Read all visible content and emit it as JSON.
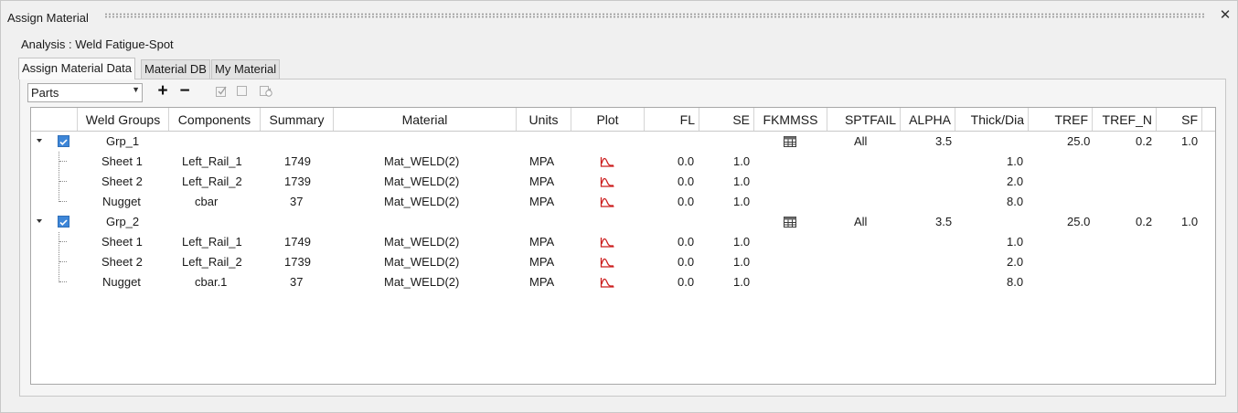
{
  "window": {
    "title": "Assign Material"
  },
  "analysis_label": "Analysis : Weld Fatigue-Spot",
  "tabs": [
    {
      "label": "Assign Material Data",
      "active": true
    },
    {
      "label": "Material DB",
      "active": false
    },
    {
      "label": "My Material",
      "active": false
    }
  ],
  "toolbar": {
    "selection_type": "Parts",
    "add": "+",
    "remove": "−"
  },
  "columns": [
    "Weld Groups",
    "Components",
    "Summary",
    "Material",
    "Units",
    "Plot",
    "FL",
    "SE",
    "FKMMSS",
    "SPTFAIL",
    "ALPHA",
    "Thick/Dia",
    "TREF",
    "TREF_N",
    "SF"
  ],
  "groups": [
    {
      "name": "Grp_1",
      "checked": true,
      "sptfail": "All",
      "alpha": "3.5",
      "tref": "25.0",
      "tref_n": "0.2",
      "sf": "1.0",
      "rows": [
        {
          "group": "Sheet 1",
          "component": "Left_Rail_1",
          "summary": "1749",
          "material": "Mat_WELD(2)",
          "units": "MPA",
          "fl": "0.0",
          "se": "1.0",
          "thick": "1.0"
        },
        {
          "group": "Sheet 2",
          "component": "Left_Rail_2",
          "summary": "1739",
          "material": "Mat_WELD(2)",
          "units": "MPA",
          "fl": "0.0",
          "se": "1.0",
          "thick": "2.0"
        },
        {
          "group": "Nugget",
          "component": "cbar",
          "summary": "37",
          "material": "Mat_WELD(2)",
          "units": "MPA",
          "fl": "0.0",
          "se": "1.0",
          "thick": "8.0"
        }
      ]
    },
    {
      "name": "Grp_2",
      "checked": true,
      "sptfail": "All",
      "alpha": "3.5",
      "tref": "25.0",
      "tref_n": "0.2",
      "sf": "1.0",
      "rows": [
        {
          "group": "Sheet 1",
          "component": "Left_Rail_1",
          "summary": "1749",
          "material": "Mat_WELD(2)",
          "units": "MPA",
          "fl": "0.0",
          "se": "1.0",
          "thick": "1.0"
        },
        {
          "group": "Sheet 2",
          "component": "Left_Rail_2",
          "summary": "1739",
          "material": "Mat_WELD(2)",
          "units": "MPA",
          "fl": "0.0",
          "se": "1.0",
          "thick": "2.0"
        },
        {
          "group": "Nugget",
          "component": "cbar.1",
          "summary": "37",
          "material": "Mat_WELD(2)",
          "units": "MPA",
          "fl": "0.0",
          "se": "1.0",
          "thick": "8.0"
        }
      ]
    }
  ],
  "icons": {
    "close": "close-icon",
    "check": "check-icon",
    "plot": "plot-curve-icon",
    "table": "table-icon"
  },
  "colors": {
    "checkbox": "#3d86d8",
    "plot": "#cc1f1f"
  }
}
